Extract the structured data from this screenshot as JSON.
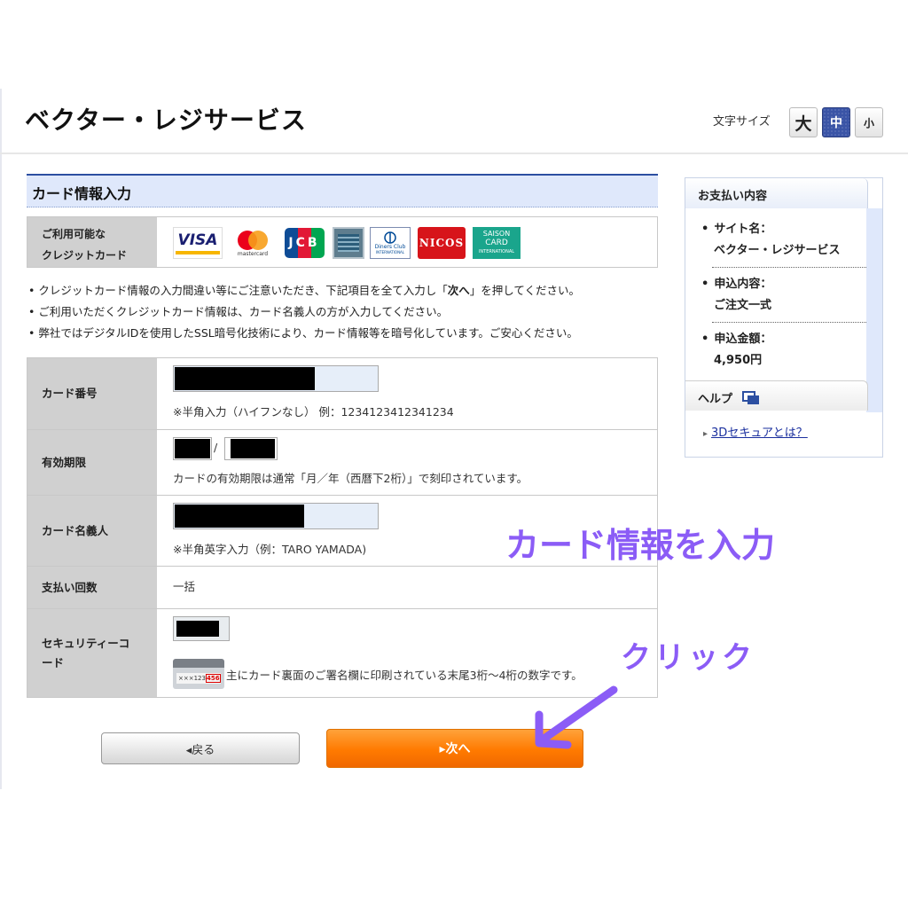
{
  "header": {
    "site_title": "ベクター・レジサービス",
    "font_size_label": "文字サイズ",
    "font_sizes": {
      "large": "大",
      "medium": "中",
      "small": "小"
    },
    "active_font_size": "medium"
  },
  "card_section": {
    "heading": "カード情報入力",
    "available_cards_label_1": "ご利用可能な",
    "available_cards_label_2": "クレジットカード",
    "logos": {
      "visa": "VISA",
      "mastercard": "mastercard",
      "jcb": "JCB",
      "diners": "Diners Club",
      "diners_sub": "INTERNATIONAL",
      "nicos": "NICOS",
      "saison_1": "SAISON",
      "saison_2": "CARD",
      "saison_3": "INTERNATIONAL"
    }
  },
  "notes": {
    "note1_pre": "クレジットカード情報の入力間違い等にご注意いただき、下記項目を全て入力し「",
    "note1_bold": "次へ",
    "note1_post": "」を押してください。",
    "note2": "ご利用いただくクレジットカード情報は、カード名義人の方が入力してください。",
    "note3": "弊社ではデジタルIDを使用したSSL暗号化技術により、カード情報等を暗号化しています。ご安心ください。"
  },
  "form": {
    "card_number_label": "カード番号",
    "card_number_hint": "※半角入力（ハイフンなし） 例：1234123412341234",
    "expiry_label": "有効期限",
    "expiry_separator": "/",
    "expiry_hint": "カードの有効期限は通常「月／年（西暦下2桁）」で刻印されています。",
    "holder_label": "カード名義人",
    "holder_hint": "※半角英字入力（例：TARO YAMADA)",
    "installments_label": "支払い回数",
    "installments_value": "一括",
    "security_label_1": "セキュリティーコ",
    "security_label_2": "ード",
    "security_hint": "主にカード裏面のご署名欄に印刷されている末尾3桁〜4桁の数字です。",
    "security_card_digits": "×××123",
    "security_card_code": "456"
  },
  "side_panel": {
    "title": "お支払い内容",
    "site_name_label": "サイト名：",
    "site_name_value": "ベクター・レジサービス",
    "application_label": "申込内容：",
    "application_value": "ご注文一式",
    "amount_label": "申込金額：",
    "amount_value": "4,950円",
    "help_title": "ヘルプ",
    "help_link": "3Dセキュアとは？"
  },
  "buttons": {
    "back": "◂戻る",
    "next": "▸次へ"
  },
  "annotations": {
    "enter_card_info": "カード情報を入力",
    "click": "クリック"
  },
  "colors": {
    "accent_blue": "#2c4fa1",
    "next_orange": "#ff7a00",
    "annotation_purple": "#8b5cf6"
  }
}
